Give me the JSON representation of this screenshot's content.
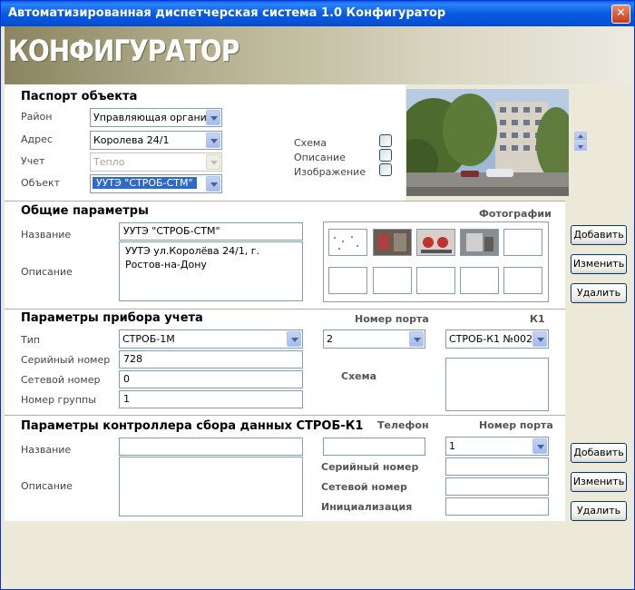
{
  "window": {
    "title": "Автоматизированная диспетчерская система 1.0 Конфигуратор",
    "close": "✕"
  },
  "banner": {
    "logo": "КОНФИГУРАТОР"
  },
  "passport": {
    "header": "Паспорт объекта",
    "district_label": "Район",
    "district_value": "Управляющая организа",
    "address_label": "Адрес",
    "address_value": "Королева 24/1",
    "account_label": "Учет",
    "account_value": "Тепло",
    "object_label": "Объект",
    "object_value": "УУТЭ \"СТРОБ-СТМ\"",
    "scheme_label": "Схема",
    "description_label": "Описание",
    "image_label": "Изображение"
  },
  "general": {
    "header": "Общие параметры",
    "photos_label": "Фотографии",
    "name_label": "Название",
    "name_value": "УУТЭ \"СТРОБ-СТМ\"",
    "desc_label": "Описание",
    "desc_value": "УУТЭ ул.Королёва 24/1, г. Ростов-на-Дону",
    "add_button": "Добавить",
    "edit_button": "Изменить",
    "delete_button": "Удалить"
  },
  "meter": {
    "header": "Параметры прибора учета",
    "port_label": "Номер порта",
    "k1_label": "К1",
    "type_label": "Тип",
    "type_value": "СТРОБ-1М",
    "port_value": "2",
    "k1_value": "СТРОБ-К1 №002",
    "serial_label": "Серийный номер",
    "serial_value": "728",
    "net_label": "Сетевой номер",
    "net_value": "0",
    "group_label": "Номер группы",
    "group_value": "1",
    "scheme_label": "Схема"
  },
  "controller": {
    "header": "Параметры контроллера сбора данных СТРОБ-К1",
    "phone_label": "Телефон",
    "port_label": "Номер порта",
    "port_value": "1",
    "name_label": "Название",
    "name_value": "",
    "desc_label": "Описание",
    "desc_value": "",
    "serial_label": "Серийный номер",
    "net_label": "Сетевой номер",
    "init_label": "Инициализация",
    "add_button": "Добавить",
    "edit_button": "Изменить",
    "delete_button": "Удалить"
  }
}
